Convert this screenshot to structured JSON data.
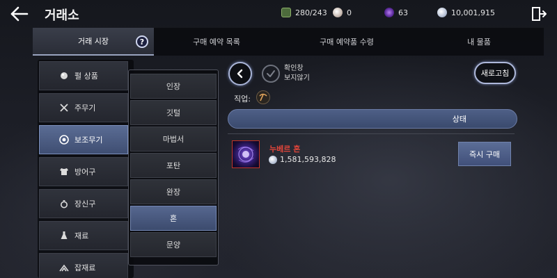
{
  "header": {
    "title": "거래소",
    "stats": [
      {
        "icon": "energy-icon",
        "value": "280/243"
      },
      {
        "icon": "pearl-icon",
        "value": "0"
      },
      {
        "icon": "crystal-icon",
        "value": "63"
      },
      {
        "icon": "silver-icon",
        "value": "10,001,915"
      }
    ]
  },
  "tabs": [
    {
      "label": "거래 시장",
      "active": true
    },
    {
      "label": "구매 예약 목록",
      "active": false
    },
    {
      "label": "구매 예약품 수령",
      "active": false
    },
    {
      "label": "내 물품",
      "active": false
    }
  ],
  "help_label": "?",
  "categories": [
    {
      "label": "펄 상품",
      "icon": "pearl-icon",
      "active": false
    },
    {
      "label": "주무기",
      "icon": "crossed-swords-icon",
      "active": false
    },
    {
      "label": "보조무기",
      "icon": "target-icon",
      "active": true
    },
    {
      "label": "방어구",
      "icon": "armor-icon",
      "active": false
    },
    {
      "label": "장신구",
      "icon": "ring-icon",
      "active": false
    },
    {
      "label": "재료",
      "icon": "potion-icon",
      "active": false
    },
    {
      "label": "잡재료",
      "icon": "misc-icon",
      "active": false
    }
  ],
  "subcategories": [
    {
      "label": "인장",
      "active": false
    },
    {
      "label": "깃털",
      "active": false
    },
    {
      "label": "마법서",
      "active": false
    },
    {
      "label": "포탄",
      "active": false
    },
    {
      "label": "완장",
      "active": false
    },
    {
      "label": "혼",
      "active": true
    },
    {
      "label": "문양",
      "active": false
    }
  ],
  "controls": {
    "confirm_line1": "확인창",
    "confirm_line2": "보지않기",
    "refresh_label": "새로고침",
    "job_label": "직업:"
  },
  "status_header": "상태",
  "listing": {
    "name": "누베르 혼",
    "price": "1,581,593,828",
    "buy_label": "즉시 구매"
  },
  "colors": {
    "accent": "#4e5f86",
    "item_name": "#e2453a"
  }
}
